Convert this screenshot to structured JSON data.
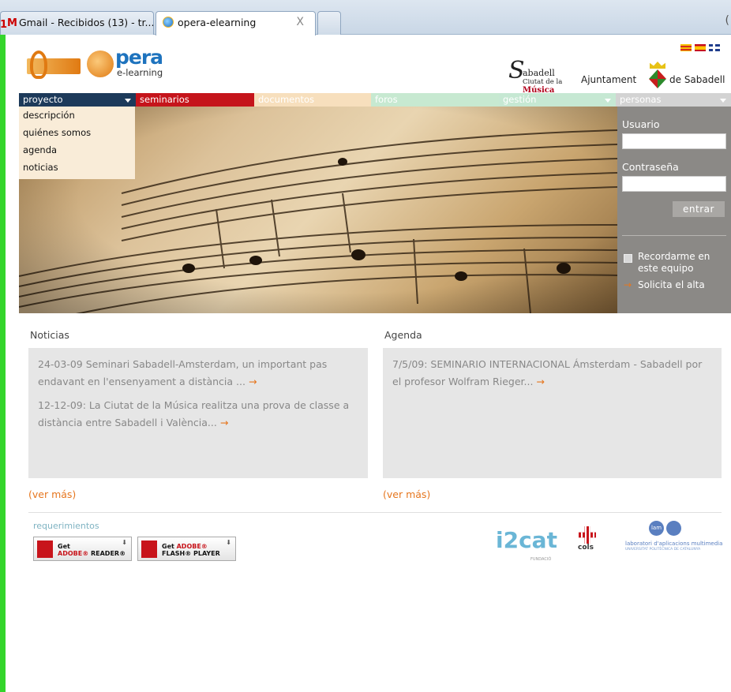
{
  "browser": {
    "tabs": [
      {
        "label": "Gmail - Recibidos (13) - tr...",
        "prefix": "M"
      },
      {
        "label": "opera-elearning"
      }
    ],
    "close_glyph": "X",
    "gmail_edge_glyph": "1"
  },
  "site": {
    "logo": {
      "big": "pera",
      "small": "e-learning"
    },
    "partner_sabadell": {
      "line1": "abadell",
      "line2_pre": "Ciutat de la ",
      "line2_bold": "Música"
    },
    "partner_ajuntament": {
      "left": "Ajuntament",
      "right": "de Sabadell"
    },
    "languages": [
      "cat-flag",
      "es-flag",
      "uk-flag"
    ],
    "nav": [
      {
        "label": "proyecto",
        "color": "#1d3a5a"
      },
      {
        "label": "seminarios",
        "color": "#c5141b"
      },
      {
        "label": "documentos",
        "color": "#f7dfbd"
      },
      {
        "label": "foros",
        "color": "#c7e9d1"
      },
      {
        "label": "gestión",
        "color": "#c6e8d3"
      },
      {
        "label": "personas",
        "color": "#d3d3d3"
      }
    ],
    "dropdown": [
      "descripción",
      "quiénes somos",
      "agenda",
      "noticias"
    ],
    "login": {
      "user_label": "Usuario",
      "password_label": "Contraseña",
      "submit": "entrar",
      "remember": "Recordarme en este equipo",
      "signup": "Solicita el alta"
    },
    "noticias": {
      "title": "Noticias",
      "items": [
        "24-03-09 Seminari Sabadell-Amsterdam, un important pas endavant en l'ensenyament a distància ...",
        "12-12-09: La Ciutat de la Música realitza una prova de classe a distància entre Sabadell i València..."
      ],
      "more": "(ver más)"
    },
    "agenda": {
      "title": "Agenda",
      "items": [
        "7/5/09: SEMINARIO INTERNACIONAL Ámsterdam - Sabadell por el profesor Wolfram Rieger..."
      ],
      "more": "(ver más)"
    },
    "footer": {
      "requirements": "requerimientos",
      "badges": [
        {
          "line1": "Get",
          "line2_red": "ADOBE®",
          "line2": " READER®"
        },
        {
          "line1": "Get ",
          "line1_red": "ADOBE®",
          "line2": "FLASH® PLAYER"
        }
      ],
      "i2cat": {
        "main": "i2cat",
        "sub": "FUNDACIÓ"
      },
      "cols": "cols",
      "lam": {
        "badge": "lam",
        "line1": "laboratori d'aplicacions multimedia",
        "line2": "UNIVERSITAT POLITÈCNICA DE CATALUNYA"
      }
    },
    "arrow_glyph": "→"
  }
}
